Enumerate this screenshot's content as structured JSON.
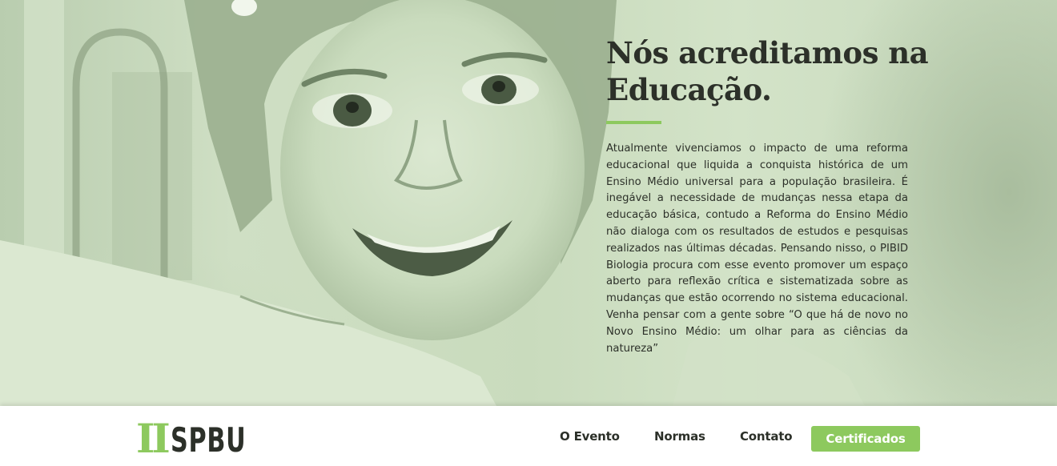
{
  "hero": {
    "headline_line1": "Nós acreditamos na",
    "headline_line2": "Educação.",
    "paragraph": "Atualmente vivenciamos o impacto de uma reforma educacional que liquida a conquista histórica de um Ensino Médio universal para a população brasileira. É inegável a necessidade de mudanças nessa etapa da educação básica, contudo a Reforma do Ensino Médio não dialoga com os resultados de estudos e pesquisas realizados nas últimas décadas. Pensando nisso, o PIBID Biologia procura com esse evento promover um espaço aberto para reflexão crítica e sistematizada sobre as mudanças que estão ocorrendo no sistema educacional. Venha pensar com a gente sobre “O que há de novo no Novo Ensino Médio: um olhar para as ciências da natureza”"
  },
  "logo": {
    "numeral": "II",
    "text": "SPBU"
  },
  "nav": {
    "items": [
      "O Evento",
      "Normas",
      "Contato"
    ],
    "cta_label": "Certificados"
  },
  "colors": {
    "accent": "#8dc95e",
    "text": "#2c3029",
    "hero_tint": "#cfdfc4"
  }
}
